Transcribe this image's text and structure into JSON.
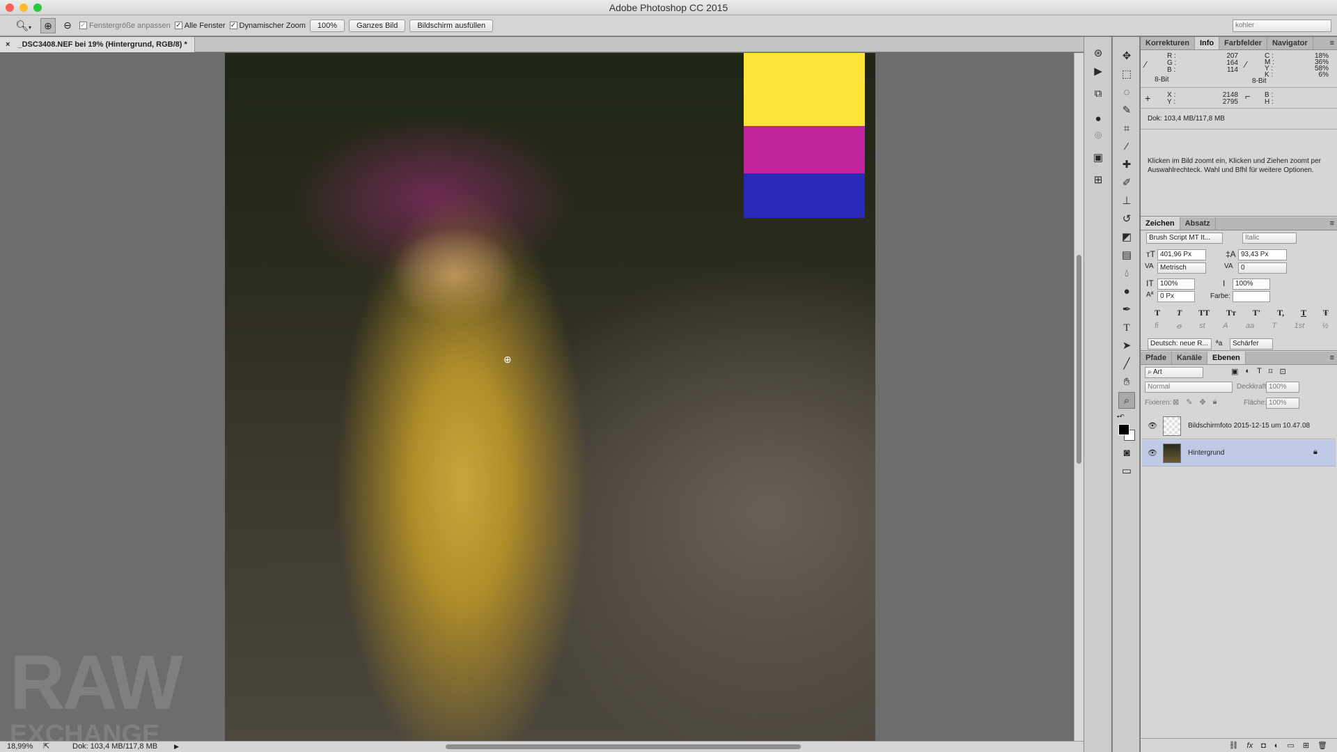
{
  "window": {
    "title": "Adobe Photoshop CC 2015"
  },
  "options_bar": {
    "tool_icon": "zoom-icon",
    "resize_windows": "Fenstergröße anpassen",
    "all_windows": "Alle Fenster",
    "scrubby_zoom": "Dynamischer Zoom",
    "btn_100": "100%",
    "btn_fit": "Ganzes Bild",
    "btn_fill": "Bildschirm ausfüllen",
    "workspace": "kohler"
  },
  "document": {
    "tab_title": "_DSC3408.NEF bei 19% (Hintergrund, RGB/8) *",
    "watermark_line1": "RAW",
    "watermark_line2": "EXCHANGE",
    "swatches": [
      "#fbe33a",
      "#c0249a",
      "#2a2ab8"
    ]
  },
  "status": {
    "zoom": "18,99%",
    "doc": "Dok: 103,4 MB/117,8 MB"
  },
  "info_panel": {
    "tabs": [
      "Korrekturen",
      "Info",
      "Farbfelder",
      "Navigator"
    ],
    "active_tab": "Info",
    "r_label": "R :",
    "r": "207",
    "g_label": "G :",
    "g": "164",
    "b_label": "B :",
    "b": "114",
    "bit1": "8-Bit",
    "c_label": "C :",
    "c": "18%",
    "m_label": "M :",
    "m": "36%",
    "y_label": "Y :",
    "y": "58%",
    "k_label": "K :",
    "k": "6%",
    "bit2": "8-Bit",
    "x_label": "X :",
    "x": "2148",
    "yy_label": "Y :",
    "yy": "2795",
    "w_label": "B :",
    "h_label": "H :",
    "doc": "Dok: 103,4 MB/117,8 MB",
    "hint": "Klicken im Bild zoomt ein, Klicken und Ziehen zoomt per Auswahlrechteck. Wahl und Bfhl für weitere Optionen."
  },
  "char_panel": {
    "tabs": [
      "Zeichen",
      "Absatz"
    ],
    "font": "Brush Script MT It...",
    "style": "Italic",
    "size": "401,96 Px",
    "leading": "93,43 Px",
    "kerning": "Metrisch",
    "tracking": "0",
    "vscale": "100%",
    "hscale": "100%",
    "baseline": "0 Px",
    "color_label": "Farbe:",
    "type_buttons": [
      "T",
      "T",
      "TT",
      "Tт",
      "T'",
      "T,",
      "T",
      "Ŧ"
    ],
    "ot_buttons": [
      "fi",
      "ꝋ",
      "st",
      "A",
      "aa",
      "T",
      "1st",
      "½"
    ],
    "language": "Deutsch: neue R...",
    "aa_label": "ªa",
    "antialias": "Schärfer"
  },
  "layers_panel": {
    "tabs": [
      "Pfade",
      "Kanäle",
      "Ebenen"
    ],
    "filter": "Art",
    "blend_mode": "Normal",
    "opacity_label": "Deckkraft:",
    "opacity": "100%",
    "lock_label": "Fixieren:",
    "fill_label": "Fläche:",
    "fill": "100%",
    "layers": [
      {
        "name": "Bildschirmfoto 2015-12-15 um 10.47.08",
        "selected": false
      },
      {
        "name": "Hintergrund",
        "selected": true
      }
    ]
  }
}
